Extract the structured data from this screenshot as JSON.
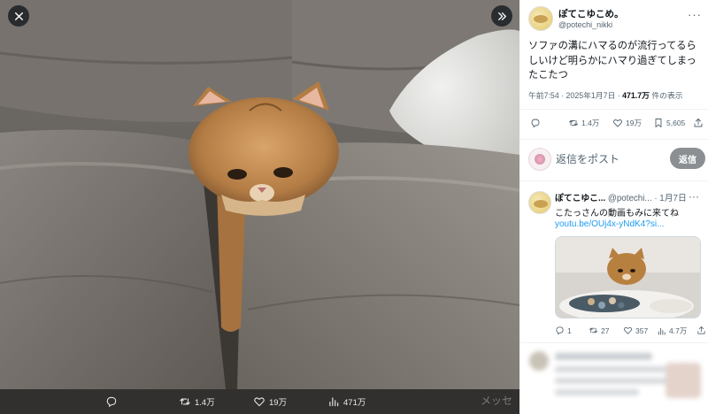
{
  "viewer": {
    "close_icon": "close-icon",
    "expand_icon": "chevron-double-right-icon",
    "actions": {
      "replies": "",
      "retweets": "1.4万",
      "likes": "19万",
      "views": "471万"
    },
    "overlay_text": "メッセ"
  },
  "post": {
    "author_name": "ぽてこゆこめ。",
    "author_handle": "@potechi_nikki",
    "text": "ソファの溝にハマるのが流行ってるらしいけど明らかにハマり過ぎてしまったこたつ",
    "time": "午前7:54 · 2025年1月7日 · ",
    "views_count": "471.7万",
    "views_label": " 件の表示",
    "stats": {
      "replies": "",
      "retweets": "1.4万",
      "likes": "19万",
      "bookmarks": "5,605"
    }
  },
  "reply_box": {
    "placeholder": "返信をポスト",
    "button_label": "返信"
  },
  "reply_tweet": {
    "author_name": "ぽてこゆこ...",
    "author_handle": "@potechi...",
    "date": "· 1月7日",
    "text": "こたっさんの動画もみに来てね",
    "link": "youtu.be/OUj4x-yNdK4?si...",
    "stats": {
      "replies": "1",
      "retweets": "27",
      "likes": "357",
      "views": "4.7万"
    }
  },
  "colors": {
    "accent": "#1d9bf0",
    "secondary_text": "#536471",
    "reply_button": "#8b8f93"
  }
}
